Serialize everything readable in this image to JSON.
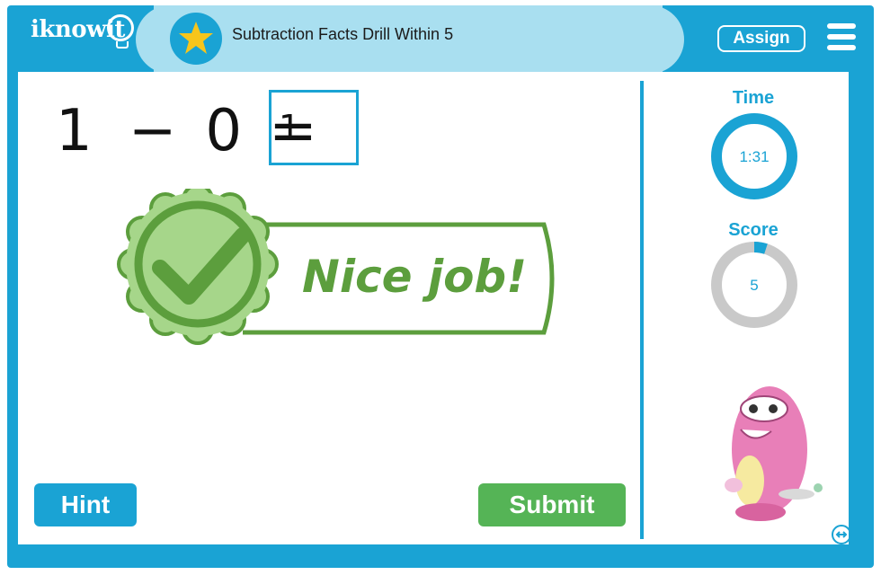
{
  "header": {
    "logo": "iknowit",
    "title": "Subtraction Facts Drill Within 5",
    "assign_label": "Assign",
    "star_icon": "star-icon",
    "menu_icon": "hamburger-menu-icon"
  },
  "problem": {
    "operand1": "1",
    "operator": "−",
    "operand2": "0",
    "equals": "=",
    "answer_value": "1"
  },
  "feedback": {
    "message": "Nice job!",
    "badge_icon": "checkmark-badge-icon",
    "color": "#5c9e3d"
  },
  "buttons": {
    "hint_label": "Hint",
    "submit_label": "Submit"
  },
  "sidebar": {
    "time_label": "Time",
    "time_value": "1:31",
    "score_label": "Score",
    "score_value": "5",
    "score_progress": 0.05
  },
  "colors": {
    "primary": "#1aa3d4",
    "header_pill": "#a9dff0",
    "submit": "#55b456",
    "ring_gray": "#c9c9c9"
  }
}
